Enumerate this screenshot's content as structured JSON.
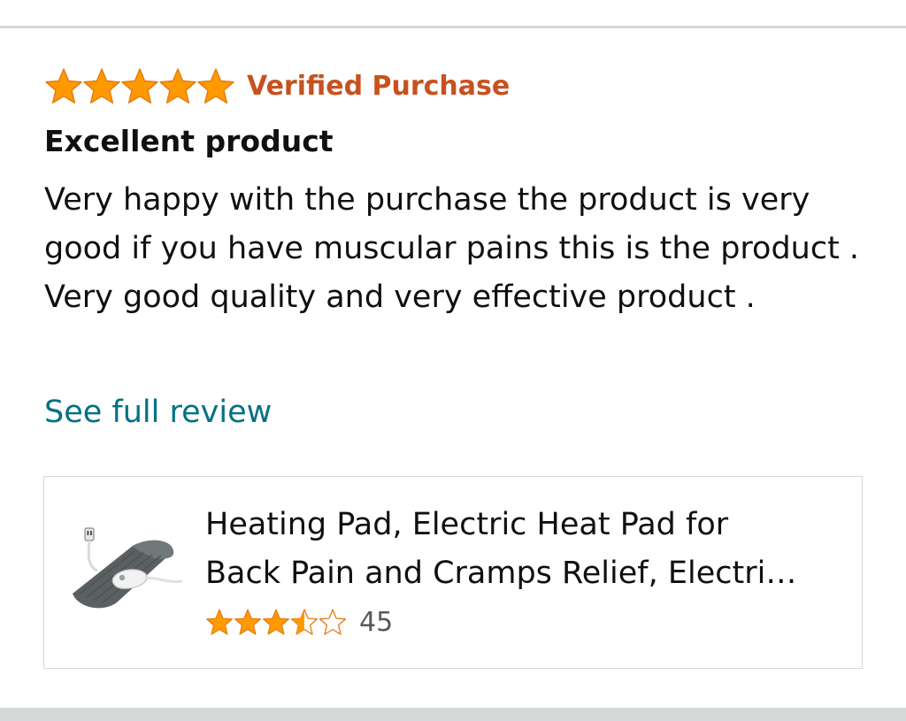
{
  "review": {
    "rating": 5,
    "max_rating": 5,
    "verified_label": "Verified Purchase",
    "title": "Excellent product",
    "body": "Very happy with the purchase the product is very good if you have muscular pains this is the product . Very good quality and very effective product .",
    "see_full_label": "See full review"
  },
  "product": {
    "title_line1": "Heating Pad, Electric Heat Pad for",
    "title_line2": "Back Pain and Cramps Relief, Electri…",
    "rating": 3.5,
    "max_rating": 5,
    "rating_count": "45",
    "image_icon": "heating-pad-image"
  },
  "colors": {
    "star": "#ff9900",
    "verified": "#c7511f",
    "link": "#007185",
    "divider": "#d5d9d9"
  }
}
